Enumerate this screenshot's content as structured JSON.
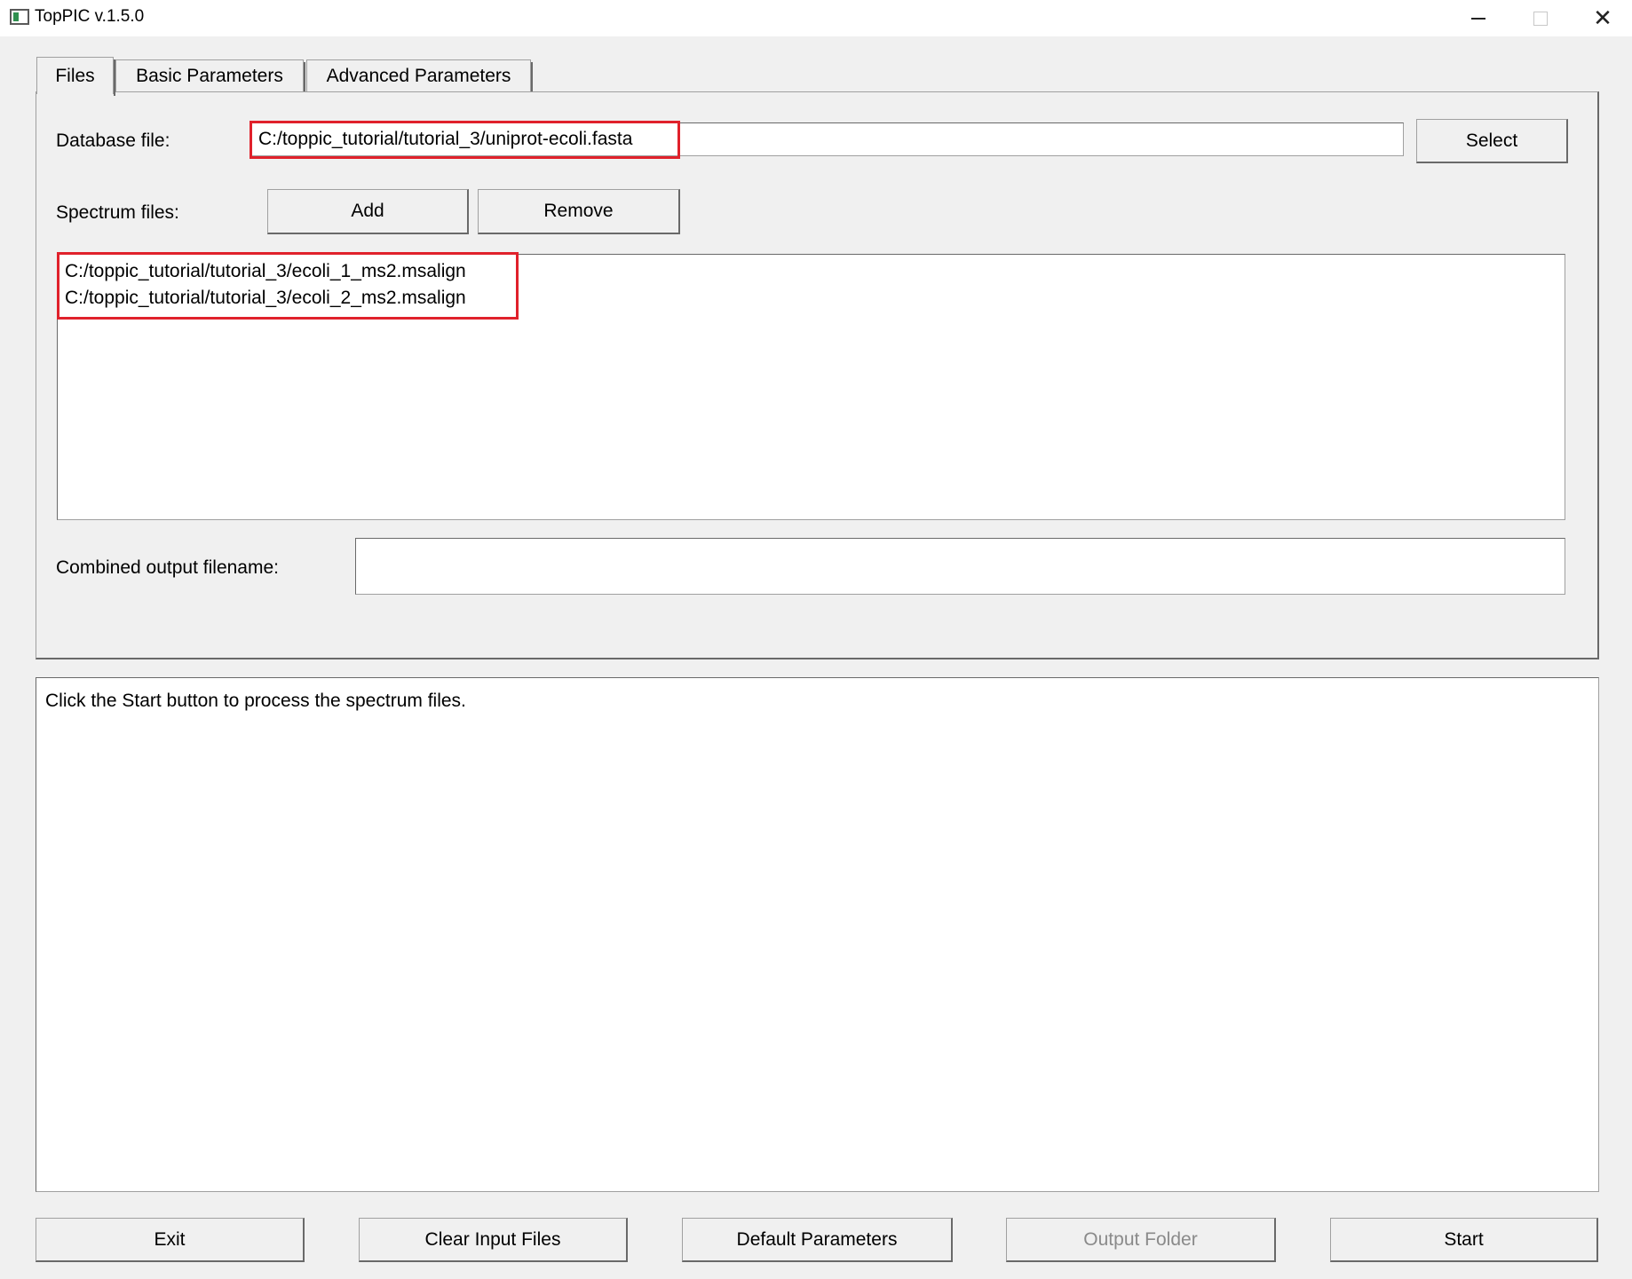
{
  "window": {
    "title": "TopPIC v.1.5.0",
    "minimize_label": "",
    "close_label": "✕"
  },
  "tabs": [
    {
      "label": "Files",
      "active": true
    },
    {
      "label": "Basic Parameters",
      "active": false
    },
    {
      "label": "Advanced Parameters",
      "active": false
    }
  ],
  "files_tab": {
    "database_label": "Database file:",
    "database_value": "C:/toppic_tutorial/tutorial_3/uniprot-ecoli.fasta",
    "select_button": "Select",
    "spectrum_label": "Spectrum files:",
    "add_button": "Add",
    "remove_button": "Remove",
    "spectrum_files": [
      "C:/toppic_tutorial/tutorial_3/ecoli_1_ms2.msalign",
      "C:/toppic_tutorial/tutorial_3/ecoli_2_ms2.msalign"
    ],
    "combined_label": "Combined output filename:",
    "combined_value": ""
  },
  "console": {
    "message": "Click the Start button to process the spectrum files."
  },
  "bottom_buttons": {
    "exit": "Exit",
    "clear_input": "Clear Input Files",
    "default_params": "Default Parameters",
    "output_folder": "Output Folder",
    "start": "Start"
  },
  "colors": {
    "highlight": "#e0212b",
    "window_bg": "#f0f0f0",
    "disabled_text": "#8a8a8a"
  }
}
